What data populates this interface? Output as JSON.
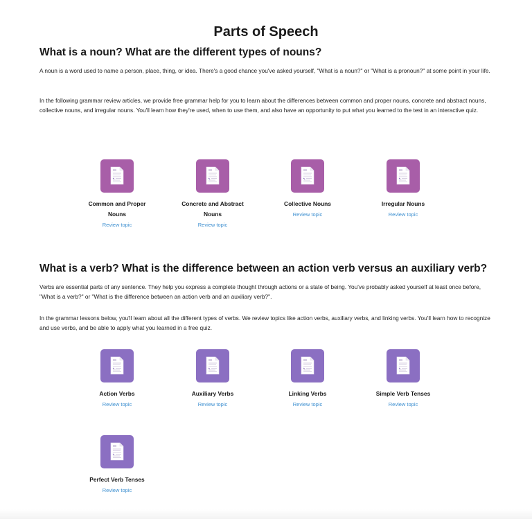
{
  "page_title": "Parts of Speech",
  "colors": {
    "noun_tile": "#a85ea8",
    "verb_tile": "#8b6fc2",
    "link": "#3d8fd0",
    "text": "#1a1a1a"
  },
  "nouns": {
    "heading": "What is a noun? What are the different types of nouns?",
    "paragraph_1": "A noun is a word used to name a person, place, thing, or idea. There's a good chance you've asked yourself, \"What is a noun?\" or \"What is a pronoun?\" at some point in your life.",
    "paragraph_2": "In the following grammar review articles, we provide free grammar help for you to learn about the differences between common and proper nouns, concrete and abstract nouns, collective nouns, and irregular nouns. You'll learn how they're used, when to use them, and also have an opportunity to put what you learned to the test in an interactive quiz.",
    "cards": [
      {
        "title": "Common and Proper Nouns",
        "link": "Review topic",
        "icon": "document-icon"
      },
      {
        "title": "Concrete and Abstract Nouns",
        "link": "Review topic",
        "icon": "document-icon"
      },
      {
        "title": "Collective Nouns",
        "link": "Review topic",
        "icon": "document-icon"
      },
      {
        "title": "Irregular Nouns",
        "link": "Review topic",
        "icon": "document-icon"
      }
    ]
  },
  "verbs": {
    "heading": "What is a verb? What is the difference between an action verb versus an auxiliary verb?",
    "paragraph_1": "Verbs are essential parts of any sentence. They help you express a complete thought through actions or a state of being. You've probably asked yourself at least once before, \"What is a verb?\" or \"What is the difference between an action verb and an auxiliary verb?\".",
    "paragraph_2": "In the grammar lessons below, you'll learn about all the different types of verbs. We review topics like action verbs, auxiliary verbs, and linking verbs. You'll learn how to recognize and use verbs, and be able to apply what you learned in a free quiz.",
    "cards": [
      {
        "title": "Action Verbs",
        "link": "Review topic",
        "icon": "document-icon"
      },
      {
        "title": "Auxiliary Verbs",
        "link": "Review topic",
        "icon": "document-icon"
      },
      {
        "title": "Linking Verbs",
        "link": "Review topic",
        "icon": "document-icon"
      },
      {
        "title": "Simple Verb Tenses",
        "link": "Review topic",
        "icon": "document-icon"
      },
      {
        "title": "Perfect Verb Tenses",
        "link": "Review topic",
        "icon": "document-icon"
      }
    ]
  }
}
